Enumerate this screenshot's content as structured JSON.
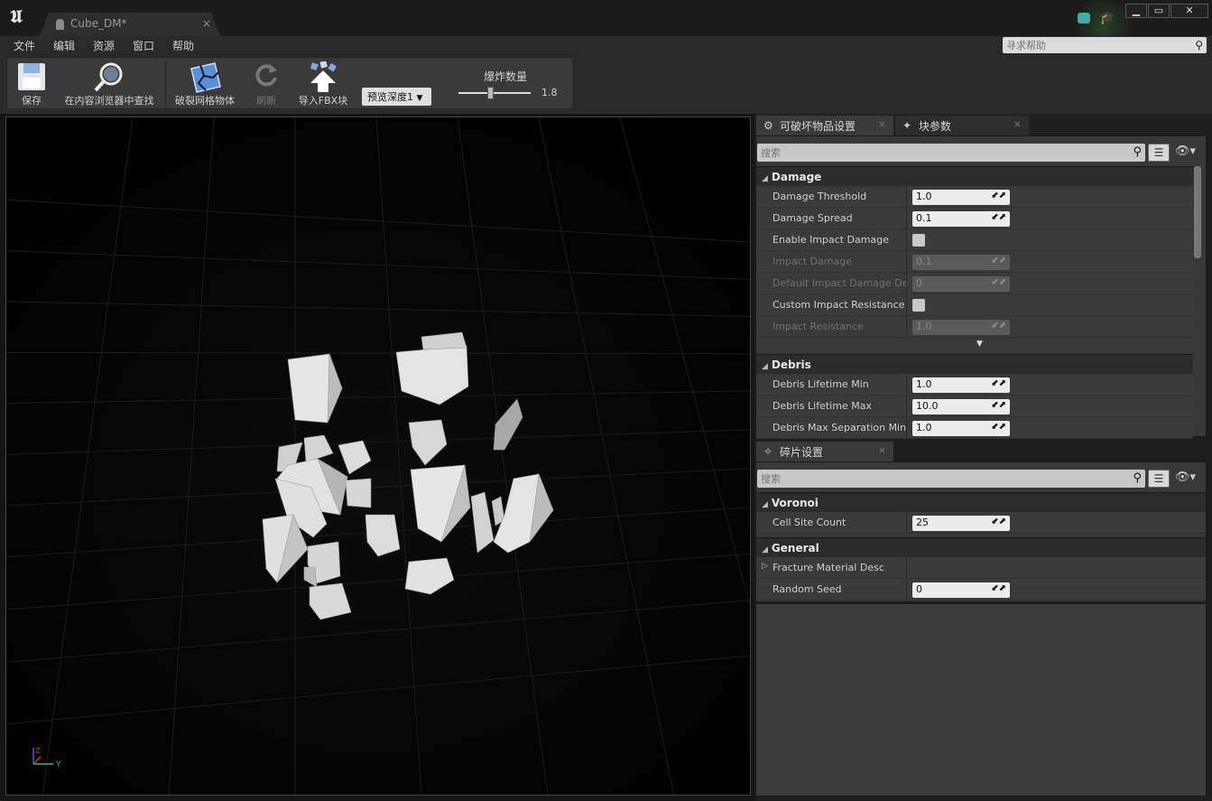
{
  "window": {
    "doc_tab": "Cube_DM*",
    "controls": {
      "minimize": "▁",
      "maximize": "▭",
      "close": "✕"
    }
  },
  "menu": {
    "items": [
      "文件",
      "编辑",
      "资源",
      "窗口",
      "帮助"
    ],
    "help_search_placeholder": "寻求帮助"
  },
  "toolbar": {
    "save": "保存",
    "find_in_browser": "在内容浏览器中查找",
    "fracture_mesh": "破裂网格物体",
    "refresh": "刷新",
    "import_fbx": "导入FBX块",
    "preview_depth": "预览深度1",
    "explode_label": "爆炸数量",
    "explode_value": "1.8",
    "explode_level": 0.45
  },
  "viewport": {
    "axis_z": "Z",
    "axis_y": "Y"
  },
  "destructible_panel": {
    "tabs": [
      "可破坏物品设置",
      "块参数"
    ],
    "search_placeholder": "搜索",
    "categories": {
      "damage": {
        "title": "Damage",
        "rows": [
          {
            "name": "Damage Threshold",
            "value": "1.0"
          },
          {
            "name": "Damage Spread",
            "value": "0.1"
          },
          {
            "name": "Enable Impact Damage",
            "value": ""
          },
          {
            "name": "Impact Damage",
            "value": "0.1"
          },
          {
            "name": "Default Impact Damage Depth",
            "value": "0"
          },
          {
            "name": "Custom Impact Resistance",
            "value": ""
          },
          {
            "name": "Impact Resistance",
            "value": "1.0"
          }
        ]
      },
      "debris": {
        "title": "Debris",
        "rows": [
          {
            "name": "Debris Lifetime Min",
            "value": "1.0"
          },
          {
            "name": "Debris Lifetime Max",
            "value": "10.0"
          },
          {
            "name": "Debris Max Separation Min",
            "value": "1.0"
          }
        ]
      }
    }
  },
  "fracture_panel": {
    "tab": "碎片设置",
    "search_placeholder": "搜索",
    "voronoi": {
      "title": "Voronoi",
      "rows": [
        {
          "name": "Cell Site Count",
          "value": "25"
        }
      ]
    },
    "general": {
      "title": "General",
      "rows": [
        {
          "name": "Fracture Material Desc",
          "value": ""
        },
        {
          "name": "Random Seed",
          "value": "0"
        }
      ]
    }
  },
  "colors": {
    "viewport_bg": "#000000",
    "panel_bg": "#383838",
    "accent": "#e8b000"
  }
}
